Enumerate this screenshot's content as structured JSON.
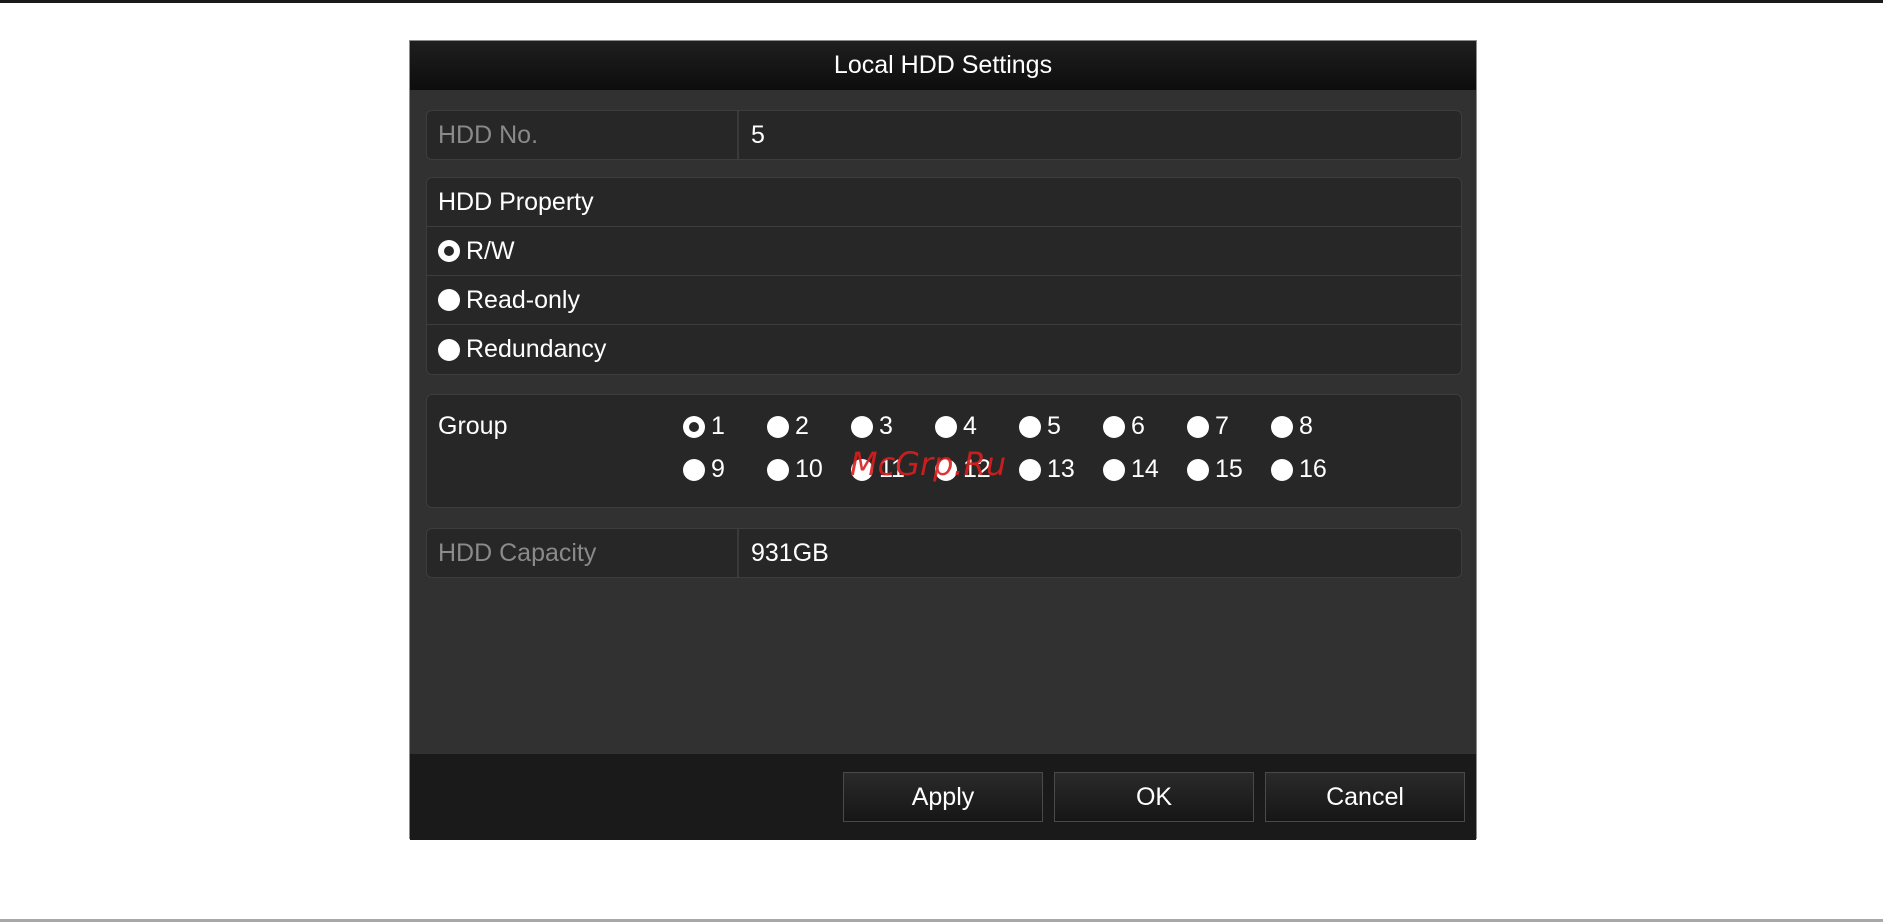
{
  "dialog": {
    "title": "Local HDD Settings"
  },
  "hdd_no": {
    "label": "HDD No.",
    "value": "5"
  },
  "property": {
    "heading": "HDD Property",
    "options": [
      {
        "label": "R/W",
        "checked": true
      },
      {
        "label": "Read-only",
        "checked": false
      },
      {
        "label": "Redundancy",
        "checked": false
      }
    ]
  },
  "group": {
    "label": "Group",
    "selected": "1",
    "options": [
      "1",
      "2",
      "3",
      "4",
      "5",
      "6",
      "7",
      "8",
      "9",
      "10",
      "11",
      "12",
      "13",
      "14",
      "15",
      "16"
    ]
  },
  "capacity": {
    "label": "HDD Capacity",
    "value": "931GB"
  },
  "buttons": {
    "apply": "Apply",
    "ok": "OK",
    "cancel": "Cancel"
  },
  "watermark": "McGrp.Ru",
  "colors": {
    "dialog_bg": "#313131",
    "panel_bg": "#272727",
    "titlebar_bg": "#0d0d0d",
    "label_text": "#8a8a8a",
    "value_text": "#ffffff",
    "watermark": "#dc1e1e"
  }
}
